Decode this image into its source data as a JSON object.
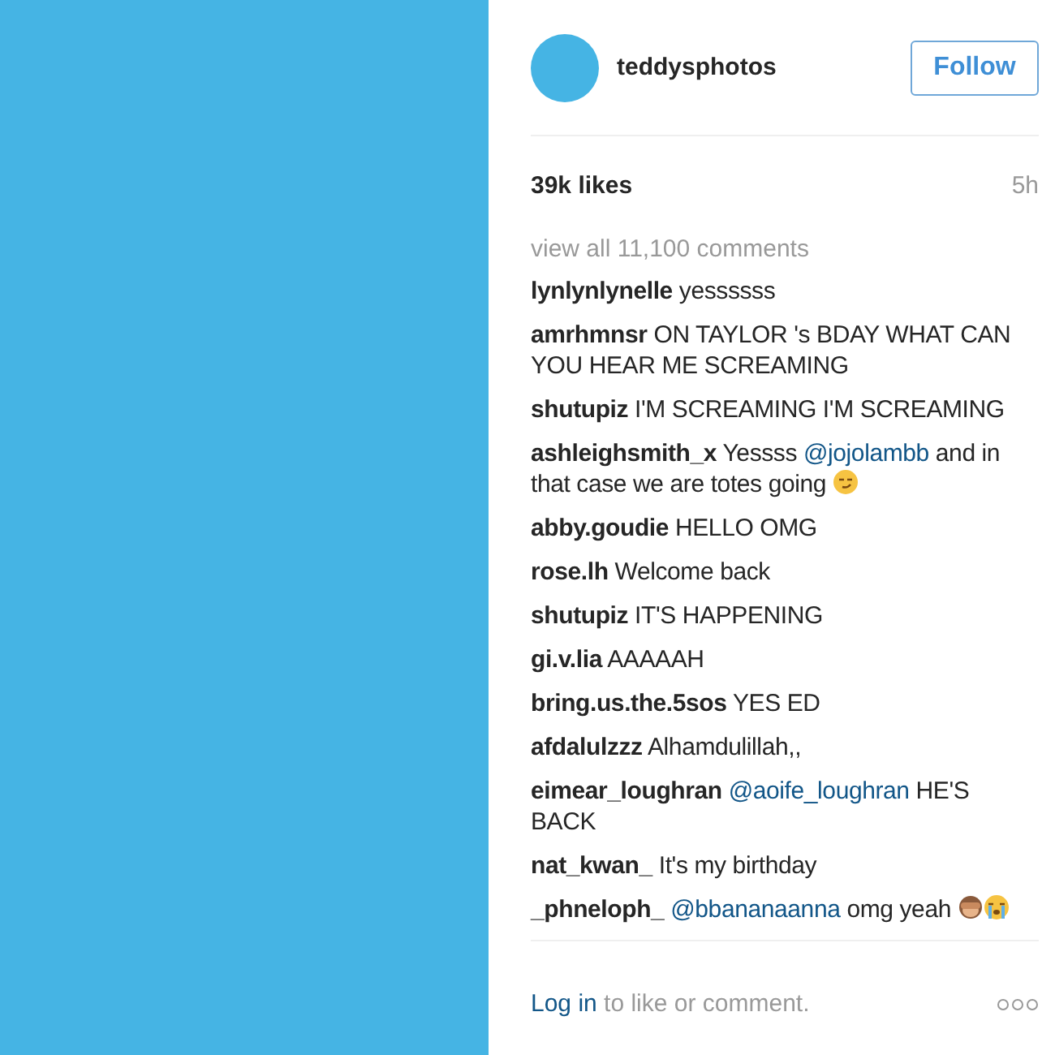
{
  "post": {
    "username": "teddysphotos",
    "follow_button": "Follow",
    "likes": "39k likes",
    "age": "5h",
    "view_all": "view all 11,100 comments"
  },
  "comments": [
    {
      "user": "lynlynlynelle",
      "segments": [
        {
          "kind": "text",
          "text": "yessssss"
        }
      ]
    },
    {
      "user": "amrhmnsr",
      "segments": [
        {
          "kind": "text",
          "text": "ON TAYLOR 's BDAY WHAT CAN YOU HEAR ME SCREAMING"
        }
      ]
    },
    {
      "user": "shutupiz",
      "segments": [
        {
          "kind": "text",
          "text": "I'M SCREAMING I'M SCREAMING"
        }
      ]
    },
    {
      "user": "ashleighsmith_x",
      "segments": [
        {
          "kind": "text",
          "text": "Yessss"
        },
        {
          "kind": "mention",
          "text": "@jojolambb"
        },
        {
          "kind": "text",
          "text": "and in that case we are totes going"
        },
        {
          "kind": "smirk"
        }
      ]
    },
    {
      "user": "abby.goudie",
      "segments": [
        {
          "kind": "text",
          "text": "HELLO OMG"
        }
      ]
    },
    {
      "user": "rose.lh",
      "segments": [
        {
          "kind": "text",
          "text": "Welcome back"
        }
      ]
    },
    {
      "user": "shutupiz",
      "segments": [
        {
          "kind": "text",
          "text": "IT'S HAPPENING"
        }
      ]
    },
    {
      "user": "gi.v.lia",
      "segments": [
        {
          "kind": "text",
          "text": "AAAAAH"
        }
      ]
    },
    {
      "user": "bring.us.the.5sos",
      "segments": [
        {
          "kind": "text",
          "text": "YES ED"
        }
      ]
    },
    {
      "user": "afdalulzzz",
      "segments": [
        {
          "kind": "text",
          "text": "Alhamdulillah,,"
        }
      ]
    },
    {
      "user": "eimear_loughran",
      "segments": [
        {
          "kind": "mention",
          "text": "@aoife_loughran"
        },
        {
          "kind": "text",
          "text": "HE'S BACK"
        }
      ]
    },
    {
      "user": "nat_kwan_",
      "segments": [
        {
          "kind": "text",
          "text": "It's my birthday"
        }
      ]
    },
    {
      "user": "_phneloph_",
      "segments": [
        {
          "kind": "mention",
          "text": "@bbananaanna"
        },
        {
          "kind": "text",
          "text": "omg yeah"
        },
        {
          "kind": "monkey"
        },
        {
          "kind": "crying"
        }
      ]
    }
  ],
  "footer": {
    "login_link": "Log in",
    "prompt": "to like or comment."
  }
}
